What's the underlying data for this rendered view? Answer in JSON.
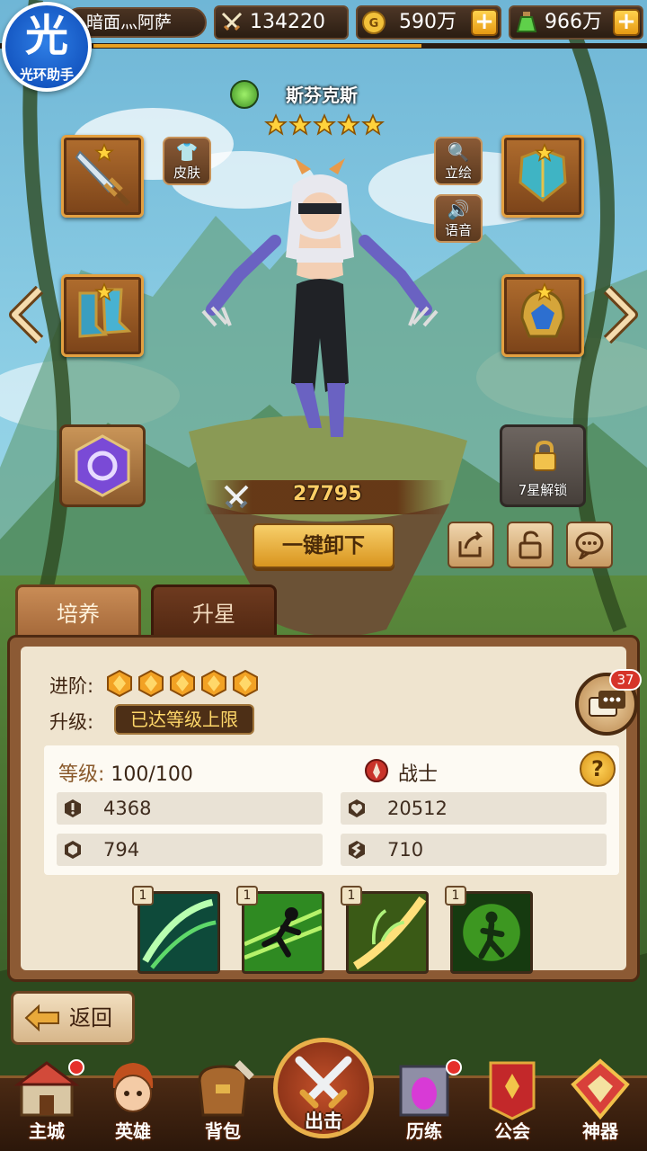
{
  "logo": {
    "text_big": "光",
    "text_small": "光环助手"
  },
  "topbar": {
    "player_name": "暗面灬阿萨",
    "power": "134220",
    "gold": "590万",
    "potion": "966万",
    "plus_label": "+"
  },
  "hero": {
    "name": "斯芬克斯",
    "star_count": 5,
    "power": "27795",
    "class_name": "战士"
  },
  "side_buttons": {
    "skin": "皮肤",
    "portrait": "立绘",
    "voice": "语音"
  },
  "lock_slot": {
    "label": "7星解锁"
  },
  "unequip_button": "一键卸下",
  "tabs": [
    {
      "label": "培养",
      "active": true
    },
    {
      "label": "升星",
      "active": false
    }
  ],
  "panel": {
    "advance_label": "进阶:",
    "advance_gems": 5,
    "upgrade_label": "升级:",
    "max_level_text": "已达等级上限",
    "level_key": "等级:",
    "level_value": "100/100",
    "help": "?",
    "stats": [
      {
        "icon": "attack-icon",
        "value": "4368"
      },
      {
        "icon": "health-icon",
        "value": "20512"
      },
      {
        "icon": "defense-icon",
        "value": "794"
      },
      {
        "icon": "speed-icon",
        "value": "710"
      }
    ],
    "skills": [
      {
        "level": "1",
        "icon": "slash-skill-icon"
      },
      {
        "level": "1",
        "icon": "dash-skill-icon"
      },
      {
        "level": "1",
        "icon": "blade-skill-icon"
      },
      {
        "level": "1",
        "icon": "aura-skill-icon"
      }
    ]
  },
  "chat": {
    "badge": "37"
  },
  "back_button": "返回",
  "nav": [
    {
      "label": "主城",
      "icon": "castle-icon",
      "dot": true
    },
    {
      "label": "英雄",
      "icon": "hero-portrait-icon",
      "dot": false
    },
    {
      "label": "背包",
      "icon": "bag-icon",
      "dot": false
    },
    {
      "label": "出击",
      "icon": "crossed-swords-icon",
      "dot": false
    },
    {
      "label": "历练",
      "icon": "portal-icon",
      "dot": true
    },
    {
      "label": "公会",
      "icon": "guild-banner-icon",
      "dot": false
    },
    {
      "label": "神器",
      "icon": "artifact-icon",
      "dot": false
    }
  ],
  "colors": {
    "accent_gold": "#e8a021",
    "panel_bg": "#efe4cf",
    "panel_frame": "#8c5a34",
    "power_text": "#ffcf66",
    "badge_red": "#d6342a"
  }
}
